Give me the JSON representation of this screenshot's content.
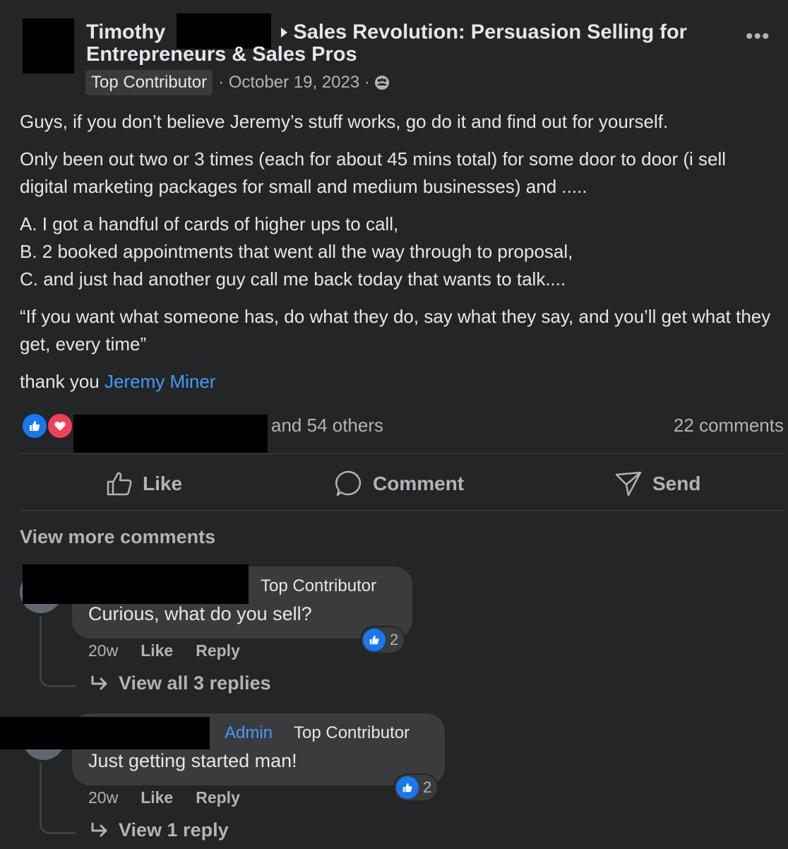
{
  "post": {
    "author_first": "Timothy",
    "group_name_line1": "Sales Revolution: Persuasion Selling for",
    "group_name_line2": "Entrepreneurs & Sales Pros",
    "author_badge": "Top Contributor",
    "date": "· October 19, 2023 ·",
    "privacy_icon": "group-icon",
    "more_icon": "more-icon",
    "more_label": "•••",
    "paragraphs": [
      "Guys, if you don’t believe Jeremy’s stuff works, go do it and find out for yourself.",
      "Only been out two or 3 times (each for about 45 mins total) for some door to door (i sell digital marketing packages for small and medium businesses) and .....",
      "A. I got a handful of cards of higher ups to call,",
      "B. 2 booked appointments that went all the way through to proposal,",
      "C. and just had another guy call me back today that  wants to talk....",
      "“If you want what someone has, do what they do, say what they say, and you’ll get what they get, every time”",
      "thank you"
    ],
    "mention": "Jeremy Miner"
  },
  "reactions": {
    "others_text": "and 54 others",
    "comments_count": "22 comments",
    "icons": [
      "like-reaction-icon",
      "love-reaction-icon"
    ]
  },
  "actions": {
    "like": "Like",
    "comment": "Comment",
    "send": "Send"
  },
  "view_more_comments": "View more comments",
  "comments": [
    {
      "badges": [
        "Top Contributor"
      ],
      "text": "Curious, what do you sell?",
      "time": "20w",
      "like": "Like",
      "reply": "Reply",
      "reaction_count": "2",
      "view_replies": "View all 3 replies"
    },
    {
      "badges": [
        "Admin",
        "Top Contributor"
      ],
      "text": "Just getting started man!",
      "time": "20w",
      "like": "Like",
      "reply": "Reply",
      "reaction_count": "2",
      "view_replies": "View 1 reply"
    }
  ],
  "colors": {
    "background": "#242526",
    "bubble": "#3a3b3c",
    "text": "#e4e6eb",
    "secondary_text": "#b0b3b8",
    "link": "#4599ff",
    "like_blue": "#1877f2",
    "love_red": "#f33e58"
  }
}
